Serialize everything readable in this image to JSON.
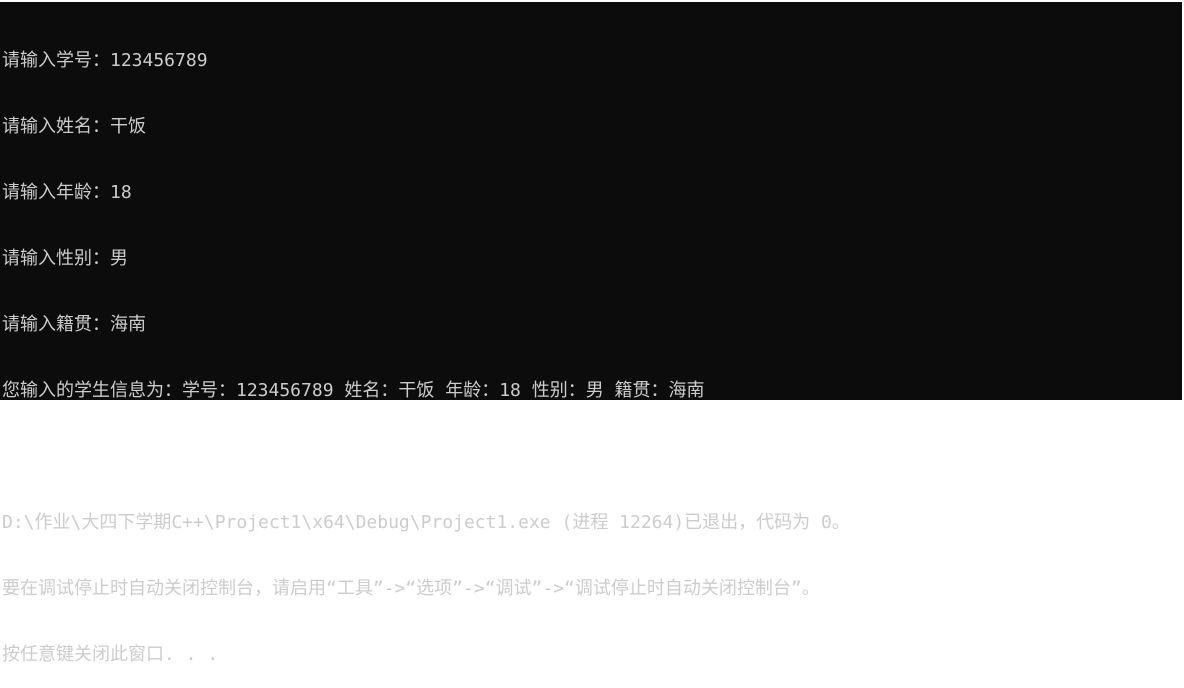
{
  "console": {
    "lines": [
      "请输入学号：123456789",
      "请输入姓名：干饭",
      "请输入年龄：18",
      "请输入性别：男",
      "请输入籍贯：海南",
      "您输入的学生信息为：学号：123456789 姓名：干饭 年龄：18 性别：男 籍贯：海南",
      "",
      "D:\\作业\\大四下学期C++\\Project1\\x64\\Debug\\Project1.exe (进程 12264)已退出，代码为 0。",
      "要在调试停止时自动关闭控制台，请启用“工具”->“选项”->“调试”->“调试停止时自动关闭控制台”。",
      "按任意键关闭此窗口. . ."
    ]
  },
  "colors": {
    "background": "#0c0c0c",
    "text": "#cccccc"
  }
}
